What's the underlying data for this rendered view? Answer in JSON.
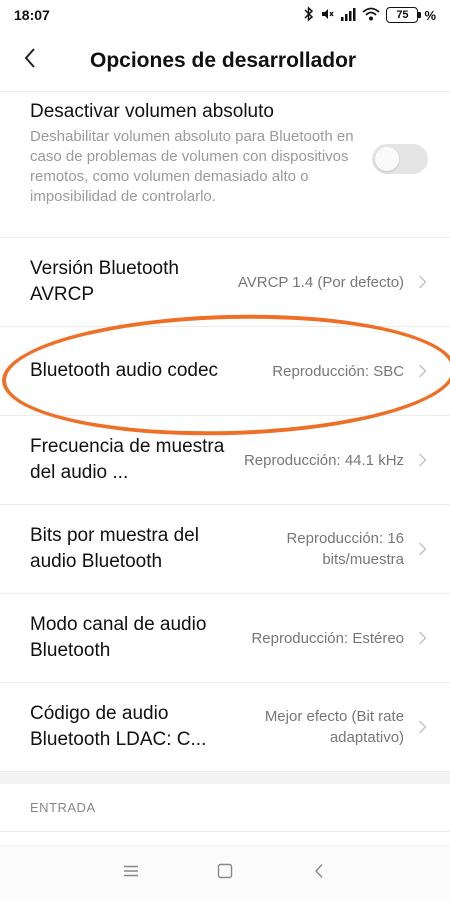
{
  "status_bar": {
    "time": "18:07",
    "icons": [
      "bluetooth-icon",
      "mute-icon",
      "signal-icon",
      "wifi-icon"
    ],
    "battery": "75",
    "battery_pct": "%"
  },
  "header": {
    "title": "Opciones de desarrollador",
    "back_icon": "chevron-left-icon"
  },
  "toggle_setting": {
    "title": "Desactivar volumen absoluto",
    "description": "Deshabilitar volumen absoluto para Bluetooth en caso de problemas de volumen con dispositivos remotos, como volumen demasiado alto o imposibilidad de controlarlo.",
    "enabled": false
  },
  "settings": [
    {
      "label": "Versión Bluetooth AVRCP",
      "value": "AVRCP 1.4 (Por defecto)"
    },
    {
      "label": "Bluetooth audio codec",
      "value": "Reproducción: SBC"
    },
    {
      "label": "Frecuencia de muestra del audio ...",
      "value": "Reproducción: 44.1 kHz"
    },
    {
      "label": "Bits por muestra del audio Bluetooth",
      "value": "Reproducción: 16 bits/muestra"
    },
    {
      "label": "Modo canal de audio Bluetooth",
      "value": "Reproducción: Estéreo"
    },
    {
      "label": "Código de audio Bluetooth LDAC: C...",
      "value": "Mejor efecto (Bit rate adaptativo)"
    }
  ],
  "section": {
    "label": "ENTRADA"
  },
  "colors": {
    "highlight": "#ee6f25",
    "divider": "#ececec",
    "secondary_text": "#777777"
  },
  "nav_bar": {
    "buttons": [
      "menu-icon",
      "home-square-icon",
      "back-triangle-icon"
    ]
  }
}
